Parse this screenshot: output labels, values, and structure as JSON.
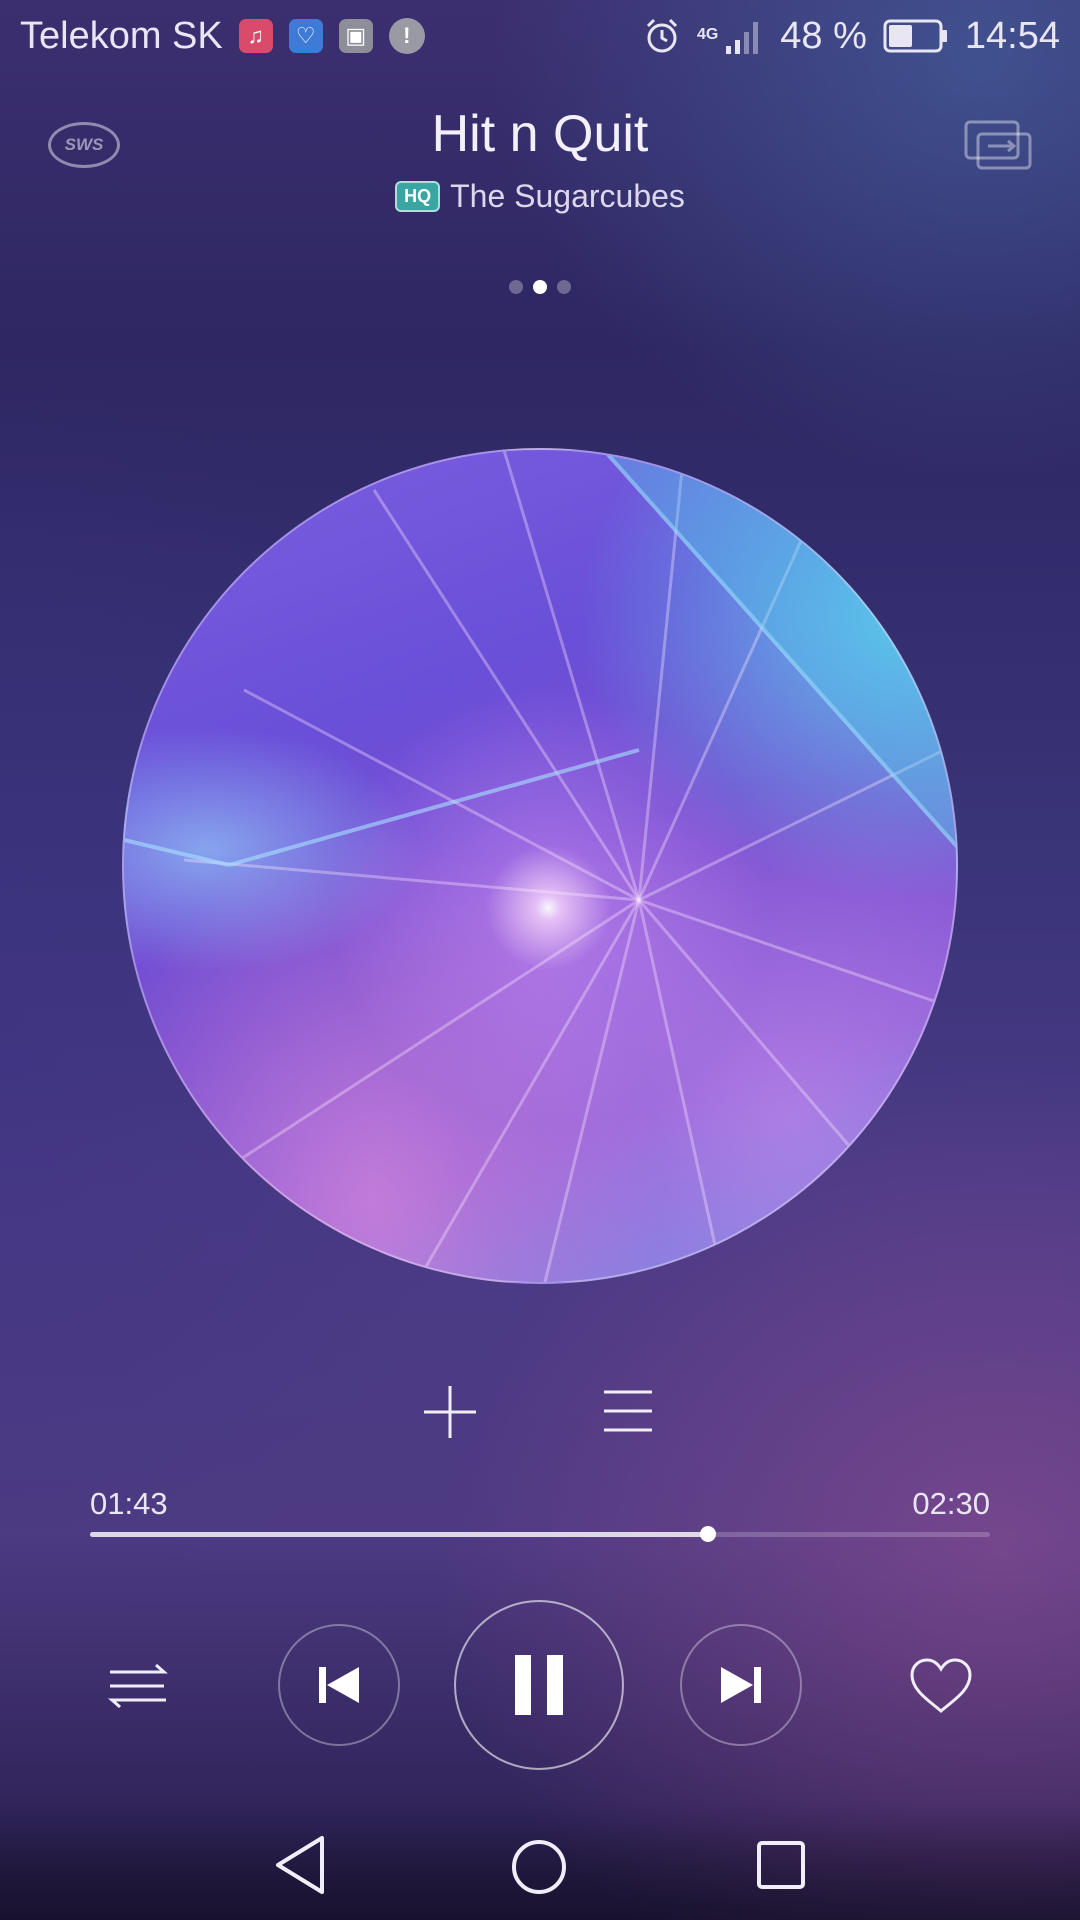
{
  "status_bar": {
    "carrier": "Telekom SK",
    "network": "4G",
    "battery": "48 %",
    "battery_level": 0.48,
    "time": "14:54",
    "notification_icons": [
      "music-note-icon",
      "health-icon",
      "gallery-icon",
      "alert-icon"
    ],
    "alert_glyph": "!"
  },
  "header": {
    "sws_label": "SWS",
    "title": "Hit n Quit",
    "hq_badge": "HQ",
    "artist": "The Sugarcubes"
  },
  "pager": {
    "count": 3,
    "active_index": 1
  },
  "playback": {
    "current_time": "01:43",
    "total_time": "02:30",
    "progress": 0.687,
    "state": "playing"
  },
  "controls": [
    "shuffle-icon",
    "previous-icon",
    "pause-icon",
    "next-icon",
    "heart-icon"
  ],
  "actions": [
    "add-icon",
    "queue-icon"
  ],
  "nav": [
    "back-icon",
    "home-icon",
    "recent-apps-icon"
  ],
  "colors": {
    "accent": "#ffffff",
    "hq_badge": "#3aa6a2",
    "background_top": "#3c2f70",
    "background_bottom": "#4d3a82"
  }
}
